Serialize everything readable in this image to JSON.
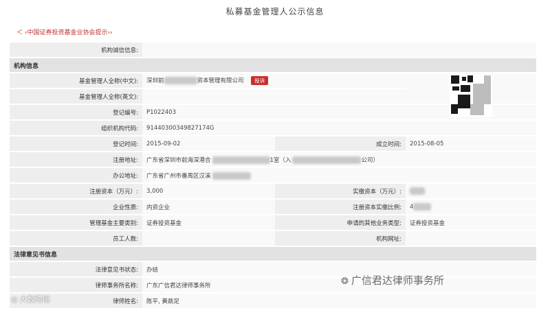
{
  "page": {
    "title": "私募基金管理人公示信息",
    "breadcrumb": "＜ ‹中国证券投资基金业协会提示››"
  },
  "rows": {
    "integrity_label": "机构诚信信息:",
    "integrity_value": "",
    "section_org": "机构信息",
    "name_cn_label": "基金管理人全称(中文):",
    "name_cn_prefix": "深圳前",
    "name_cn_suffix": "资本管理有限公司",
    "name_cn_badge": "投诉",
    "name_en_label": "基金管理人全称(英文):",
    "name_en_value": "",
    "reg_no_label": "登记编号:",
    "reg_no_value": "P1022403",
    "org_code_label": "组织机构代码:",
    "org_code_value": "91440300349827174G",
    "reg_date_label": "登记时间:",
    "reg_date_value": "2015-09-02",
    "est_date_label": "成立时间:",
    "est_date_value": "2015-08-05",
    "reg_addr_label": "注册地址:",
    "reg_addr_value": "广东省深圳市前海深港合",
    "reg_addr_mid": "1室（入",
    "reg_addr_end": "公司）",
    "office_addr_label": "办公地址:",
    "office_addr_value": "广东省广州市番禺区汉溪",
    "reg_capital_label": "注册资本（万元）:",
    "reg_capital_value": "3,000",
    "paid_capital_label": "实缴资本（万元）:",
    "paid_capital_value": "",
    "company_type_label": "企业性质:",
    "company_type_value": "内资企业",
    "paid_ratio_label": "注册资本实缴比例:",
    "paid_ratio_value": "4",
    "fund_type_label": "管理基金主要类别:",
    "fund_type_value": "证券投资基金",
    "other_biz_label": "申请的其他业务类型:",
    "other_biz_value": "证券投资基金",
    "staff_label": "员工人数:",
    "staff_value": "",
    "website_label": "机构网址:",
    "website_value": "",
    "section_legal": "法律意见书信息",
    "legal_status_label": "法律意见书状态:",
    "legal_status_value": "办结",
    "law_firm_label": "律师事务所名称:",
    "law_firm_value": "广东广信君达律师事务所",
    "lawyer_label": "律师姓名:",
    "lawyer_value": "陈平, 黄鼎足"
  },
  "watermarks": {
    "right": "广信君达律师事务所",
    "left": "大数跨境"
  },
  "colors": {
    "label_bg": "#eeeeee",
    "value_bg": "#f9f9f9",
    "section_bg": "#e2e2e2",
    "badge": "#c8312e",
    "crumb": "#c0302e"
  }
}
